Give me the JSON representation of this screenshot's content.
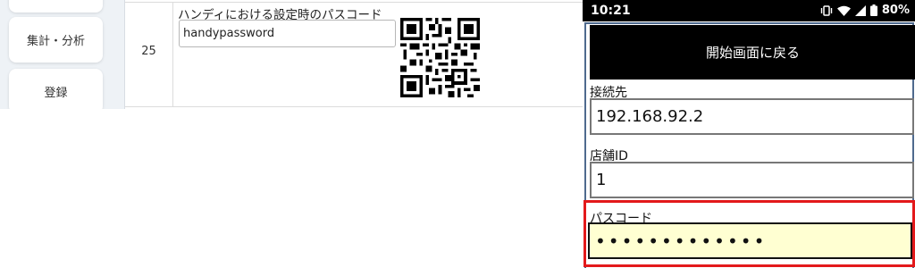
{
  "sidebar": {
    "report_label": "集計・分析",
    "register_label": "登録"
  },
  "settings_row": {
    "number": "25",
    "label": "ハンディにおける設定時のパスコード",
    "value": "handypassword"
  },
  "status_bar": {
    "time": "10:21",
    "battery": "80%",
    "icons": [
      "vibrate-icon",
      "wifi-icon",
      "signal-icon",
      "battery-icon"
    ]
  },
  "handy_app": {
    "back_button_label": "開始画面に戻る",
    "connection_label": "接続先",
    "connection_value": "192.168.92.2",
    "store_label": "店舗ID",
    "store_value": "1",
    "passcode_label": "パスコード",
    "passcode_masked": "•••••••••••••"
  },
  "colors": {
    "highlight": "#e3191b",
    "passcode_background": "#ffffd2",
    "app_border": "#4f6a8e"
  }
}
